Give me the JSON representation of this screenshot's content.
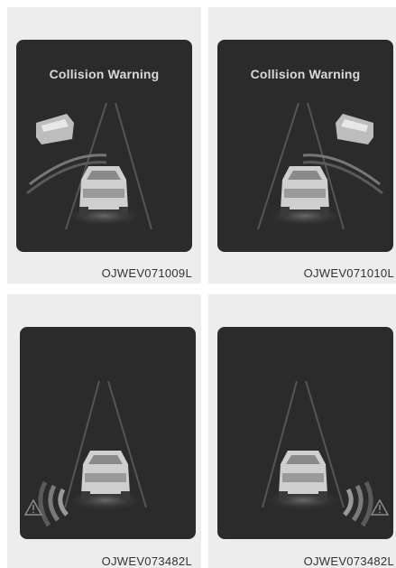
{
  "figures": [
    {
      "title": "Collision Warning",
      "caption": "OJWEV071009L",
      "side": "left",
      "type": "collision"
    },
    {
      "title": "Collision Warning",
      "caption": "OJWEV071010L",
      "side": "right",
      "type": "collision"
    },
    {
      "title": "",
      "caption": "OJWEV073482L",
      "side": "left",
      "type": "sensor"
    },
    {
      "title": "",
      "caption": "OJWEV073482L",
      "side": "right",
      "type": "sensor"
    }
  ],
  "colors": {
    "panel": "#ededed",
    "screen": "#2b2b2b",
    "text": "#d9d9d9",
    "caption": "#333333"
  }
}
